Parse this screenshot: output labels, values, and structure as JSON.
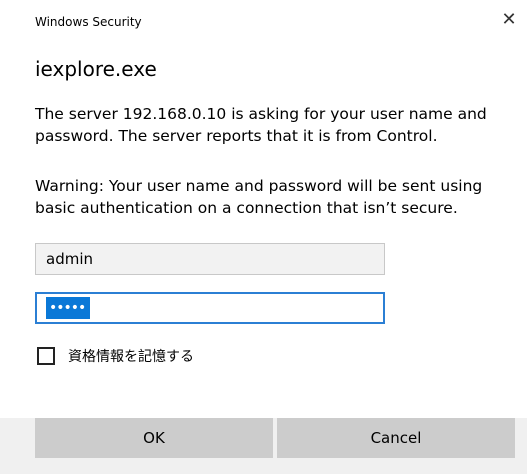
{
  "window": {
    "title": "Windows Security",
    "close_glyph": "✕"
  },
  "app_title": "iexplore.exe",
  "messages": {
    "server_request": "The server 192.168.0.10 is asking for your user name and password. The server reports that it is from Control.",
    "warning": "Warning: Your user name and password will be sent using basic authentication on a connection that isn’t secure."
  },
  "fields": {
    "username": "admin",
    "password_mask": "•••••"
  },
  "remember": {
    "label": "資格情報を記憶する",
    "checked": false
  },
  "buttons": {
    "ok": "OK",
    "cancel": "Cancel"
  },
  "colors": {
    "accent": "#0a78d7",
    "focus_border": "#2b7fd4",
    "button_bg": "#cccccc"
  }
}
